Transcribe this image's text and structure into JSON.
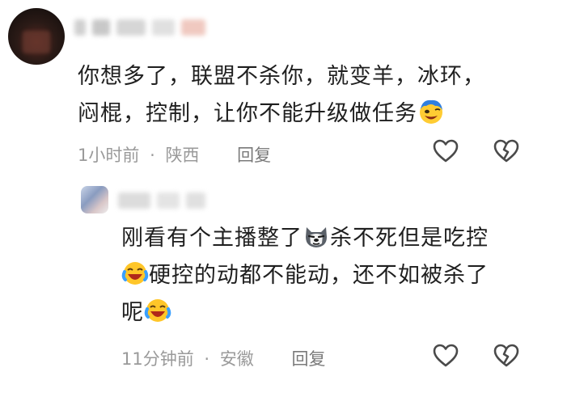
{
  "comments": [
    {
      "text_lines": [
        "你想多了，联盟不杀你，就变羊，冰环，",
        "闷棍，控制，让你不能升级做任务"
      ],
      "time": "1小时前",
      "location": "陕西",
      "reply_label": "回复",
      "trailing_emoji": "laughing-face-emoji"
    },
    {
      "text_lines": [
        "刚看有个主播整了",
        "杀不死但是吃控",
        "硬控的动都不能动，还不如被杀了",
        "呢"
      ],
      "time": "11分钟前",
      "location": "安徽",
      "reply_label": "回复",
      "emojis": [
        "husky-dog-emoji",
        "crying-laughing-face-emoji"
      ]
    }
  ],
  "meta_separator": "·",
  "icons": {
    "like": "heart-icon",
    "dislike": "broken-heart-icon"
  },
  "colors": {
    "text": "#1f1f1f",
    "meta": "#9a9a9a",
    "icon_stroke": "#4a4a4a"
  }
}
